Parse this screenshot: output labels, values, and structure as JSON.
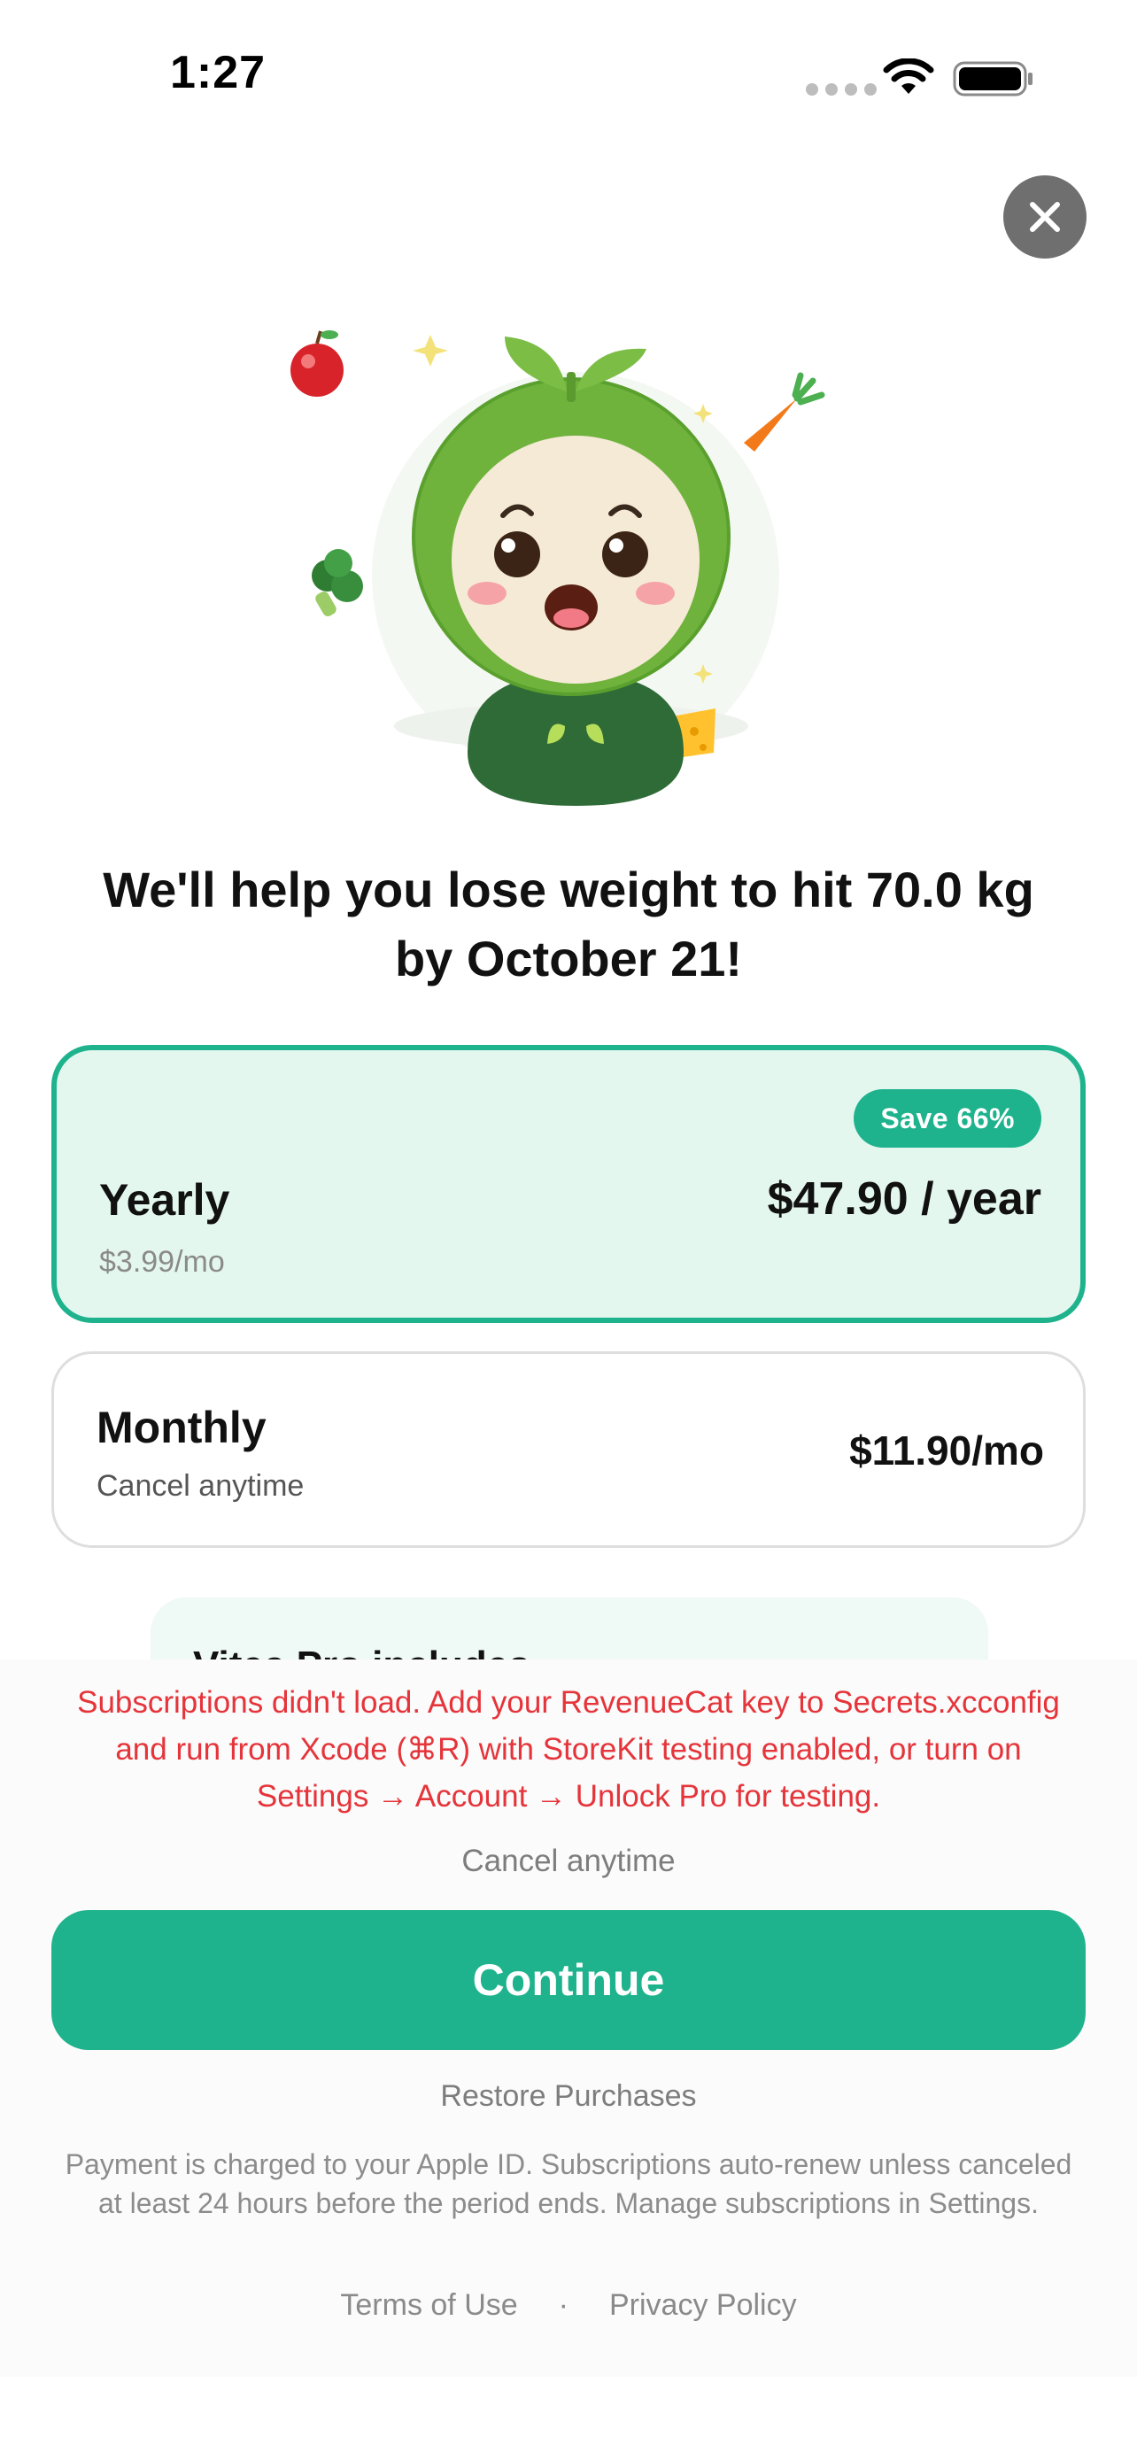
{
  "status_bar": {
    "time": "1:27"
  },
  "icons": {
    "close": "close-icon",
    "wifi": "wifi-icon",
    "battery": "battery-icon",
    "signal": "signal-dots-icon",
    "mascot": "sprout-mascot-illustration",
    "apple": "apple-emoji",
    "carrot": "carrot-emoji",
    "broccoli": "broccoli-emoji",
    "cheese": "cheese-emoji",
    "sparkle": "sparkle-icon"
  },
  "headline": "We'll help you lose weight to hit 70.0 kg by October 21!",
  "plans": {
    "yearly": {
      "badge": "Save 66%",
      "name": "Yearly",
      "sub": "$3.99/mo",
      "price": "$47.90 / year",
      "selected": true
    },
    "monthly": {
      "name": "Monthly",
      "sub": "Cancel anytime",
      "price": "$11.90/mo",
      "selected": false
    }
  },
  "includes": {
    "title": "Vitea Pro includes"
  },
  "bottom": {
    "error": "Subscriptions didn't load. Add your RevenueCat key to Secrets.xcconfig and run from Xcode (⌘R) with StoreKit testing enabled, or turn on Settings → Account → Unlock Pro for testing.",
    "cancel_anytime": "Cancel anytime",
    "continue_label": "Continue",
    "restore_label": "Restore Purchases",
    "legal": "Payment is charged to your Apple ID. Subscriptions auto-renew unless canceled at least 24 hours before the period ends. Manage subscriptions in Settings.",
    "terms_label": "Terms of Use",
    "separator": "·",
    "privacy_label": "Privacy Policy"
  },
  "colors": {
    "accent": "#1eb38d",
    "accent_bg": "#e4f7ef",
    "error": "#e5343a",
    "muted": "#7d7d7d"
  }
}
